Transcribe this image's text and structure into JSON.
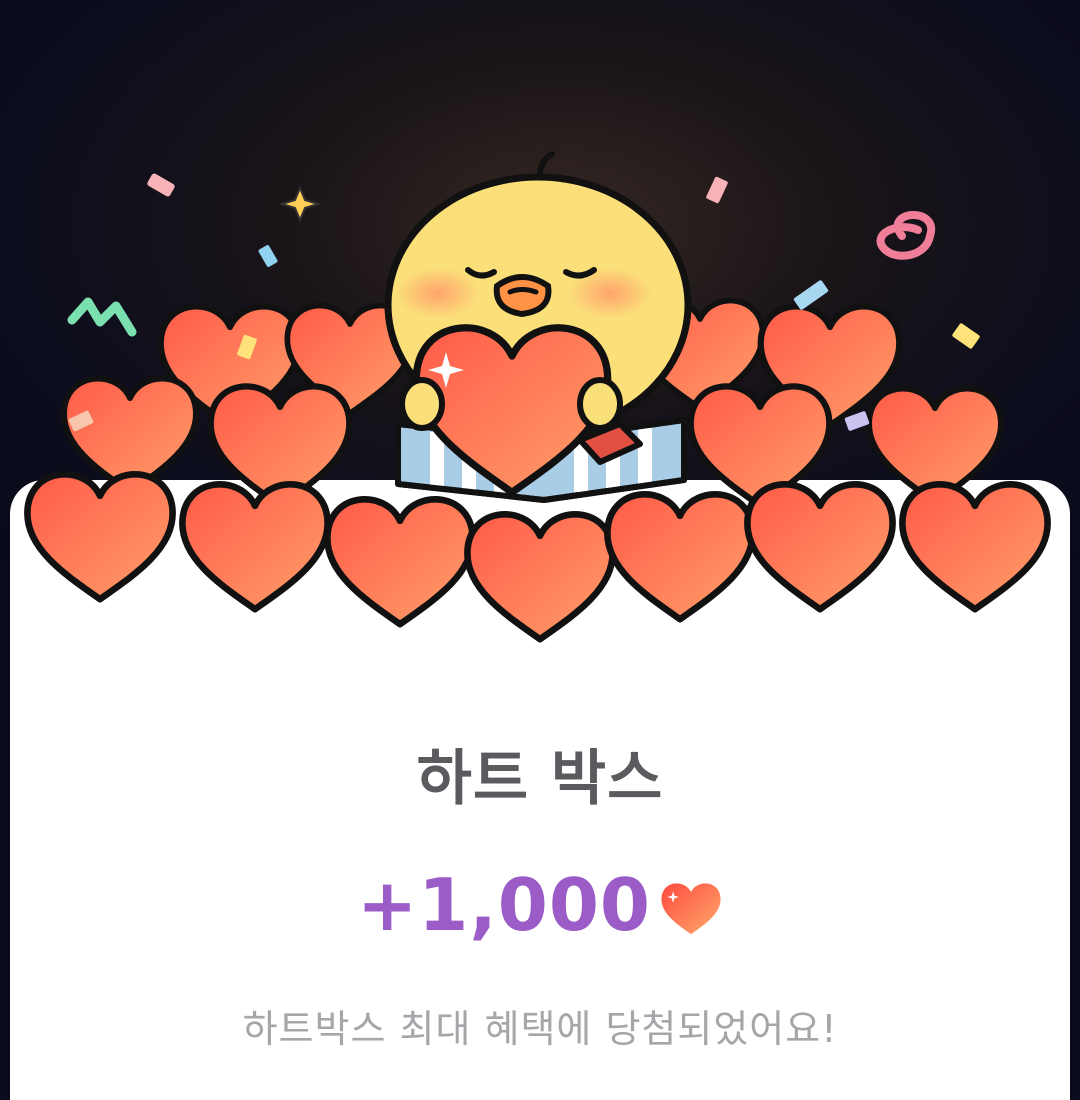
{
  "card": {
    "title": "하트 박스",
    "amount": "+1,000",
    "message": "하트박스 최대 혜택에 당첨되었어요!"
  },
  "icons": {
    "reward_icon": "heart-icon",
    "mascot": "yellow-chick-character",
    "confetti": "confetti-icon"
  },
  "colors": {
    "heart": "#ff6a52",
    "heart_light": "#ff9a66",
    "amount_text": "#9b5cc7",
    "title_text": "#5b5b5f",
    "message_text": "#a6a6aa",
    "chick": "#ffe27a"
  }
}
